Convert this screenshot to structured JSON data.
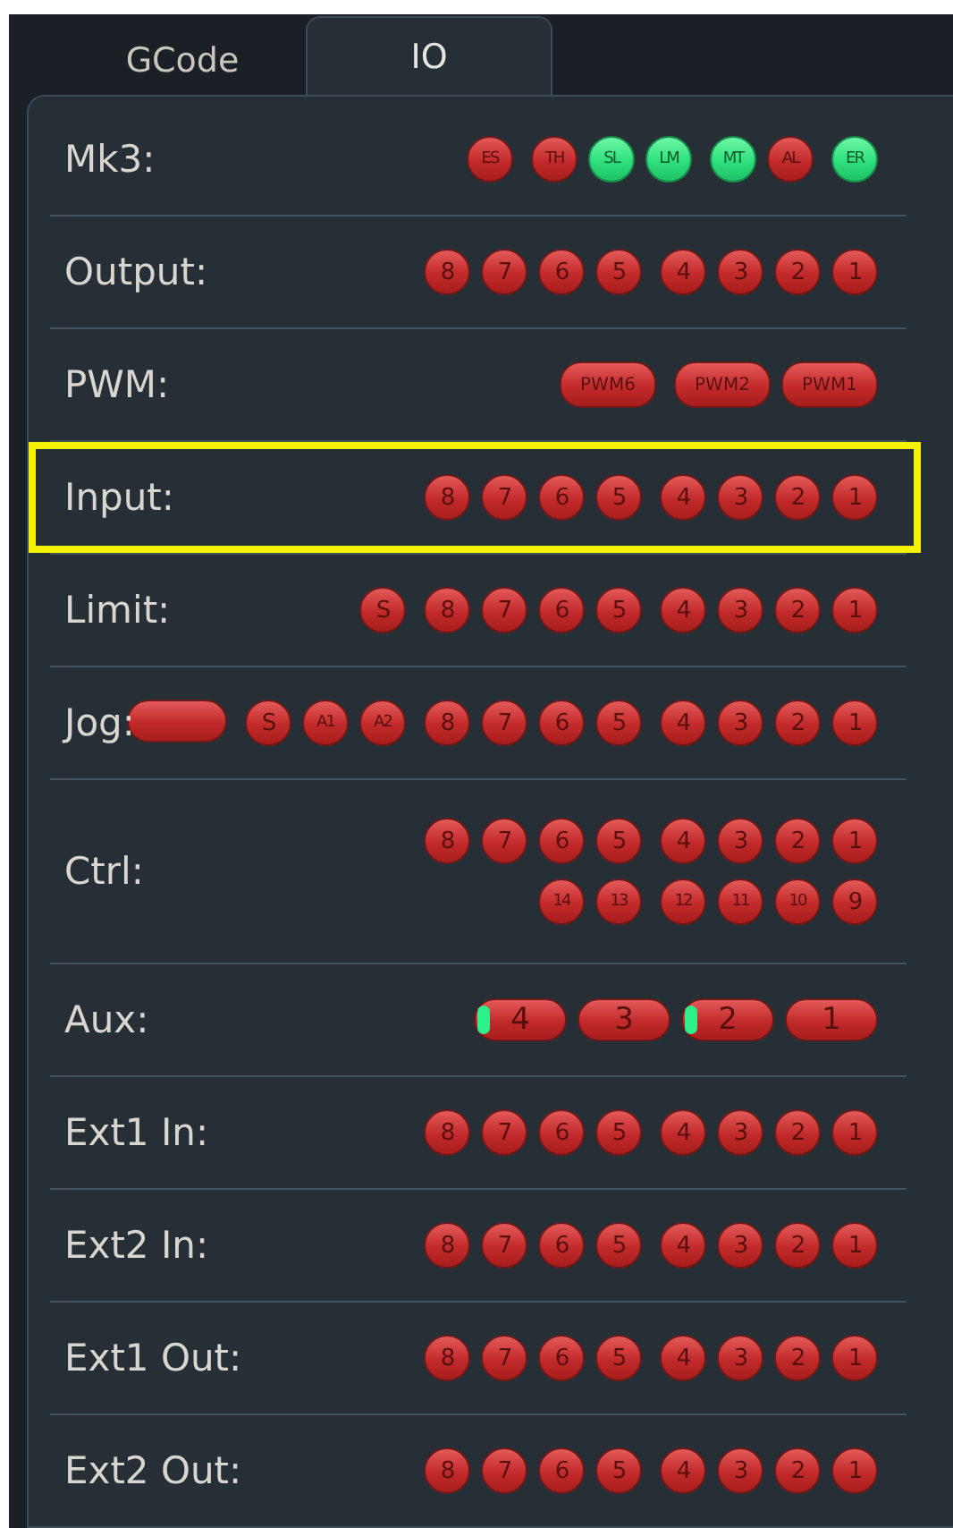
{
  "tabs": [
    {
      "label": "GCode",
      "selected": false
    },
    {
      "label": "IO",
      "selected": true
    }
  ],
  "rows": [
    {
      "label": "Mk3:",
      "highlighted": false,
      "lines": [
        [
          [
            {
              "kind": "dot",
              "label": "ES",
              "on": false
            }
          ],
          [
            {
              "kind": "dot",
              "label": "TH",
              "on": false
            },
            {
              "kind": "dot",
              "label": "SL",
              "on": true
            },
            {
              "kind": "dot",
              "label": "LM",
              "on": true
            }
          ],
          [
            {
              "kind": "dot",
              "label": "MT",
              "on": true
            },
            {
              "kind": "dot",
              "label": "AL",
              "on": false
            }
          ],
          [
            {
              "kind": "dot",
              "label": "ER",
              "on": true
            }
          ]
        ]
      ]
    },
    {
      "label": "Output:",
      "highlighted": false,
      "lines": [
        [
          [
            {
              "kind": "dot",
              "label": "8",
              "on": false
            },
            {
              "kind": "dot",
              "label": "7",
              "on": false
            },
            {
              "kind": "dot",
              "label": "6",
              "on": false
            },
            {
              "kind": "dot",
              "label": "5",
              "on": false
            }
          ],
          [
            {
              "kind": "dot",
              "label": "4",
              "on": false
            },
            {
              "kind": "dot",
              "label": "3",
              "on": false
            },
            {
              "kind": "dot",
              "label": "2",
              "on": false
            },
            {
              "kind": "dot",
              "label": "1",
              "on": false
            }
          ]
        ]
      ]
    },
    {
      "label": "PWM:",
      "highlighted": false,
      "lines": [
        [
          [
            {
              "kind": "pill",
              "label": "PWM6",
              "on": false
            }
          ],
          [
            {
              "kind": "pill",
              "label": "PWM2",
              "on": false
            },
            {
              "kind": "pill",
              "label": "PWM1",
              "on": false
            }
          ]
        ]
      ]
    },
    {
      "label": "Input:",
      "highlighted": true,
      "lines": [
        [
          [
            {
              "kind": "dot",
              "label": "8",
              "on": false
            },
            {
              "kind": "dot",
              "label": "7",
              "on": false
            },
            {
              "kind": "dot",
              "label": "6",
              "on": false
            },
            {
              "kind": "dot",
              "label": "5",
              "on": false
            }
          ],
          [
            {
              "kind": "dot",
              "label": "4",
              "on": false
            },
            {
              "kind": "dot",
              "label": "3",
              "on": false
            },
            {
              "kind": "dot",
              "label": "2",
              "on": false
            },
            {
              "kind": "dot",
              "label": "1",
              "on": false
            }
          ]
        ]
      ]
    },
    {
      "label": "Limit:",
      "highlighted": false,
      "lines": [
        [
          [
            {
              "kind": "dot",
              "label": "S",
              "on": false
            }
          ],
          [
            {
              "kind": "dot",
              "label": "8",
              "on": false
            },
            {
              "kind": "dot",
              "label": "7",
              "on": false
            },
            {
              "kind": "dot",
              "label": "6",
              "on": false
            },
            {
              "kind": "dot",
              "label": "5",
              "on": false
            }
          ],
          [
            {
              "kind": "dot",
              "label": "4",
              "on": false
            },
            {
              "kind": "dot",
              "label": "3",
              "on": false
            },
            {
              "kind": "dot",
              "label": "2",
              "on": false
            },
            {
              "kind": "dot",
              "label": "1",
              "on": false
            }
          ]
        ]
      ]
    },
    {
      "label": "Jog:",
      "highlighted": false,
      "lines": [
        [
          [
            {
              "kind": "pill",
              "on": false
            }
          ],
          [
            {
              "kind": "dot",
              "label": "S",
              "on": false
            },
            {
              "kind": "dot",
              "label": "A1",
              "on": false
            },
            {
              "kind": "dot",
              "label": "A2",
              "on": false
            }
          ],
          [
            {
              "kind": "dot",
              "label": "8",
              "on": false
            },
            {
              "kind": "dot",
              "label": "7",
              "on": false
            },
            {
              "kind": "dot",
              "label": "6",
              "on": false
            },
            {
              "kind": "dot",
              "label": "5",
              "on": false
            }
          ],
          [
            {
              "kind": "dot",
              "label": "4",
              "on": false
            },
            {
              "kind": "dot",
              "label": "3",
              "on": false
            },
            {
              "kind": "dot",
              "label": "2",
              "on": false
            },
            {
              "kind": "dot",
              "label": "1",
              "on": false
            }
          ]
        ]
      ]
    },
    {
      "label": "Ctrl:",
      "highlighted": false,
      "lines": [
        [
          [
            {
              "kind": "dot",
              "label": "8",
              "on": false
            },
            {
              "kind": "dot",
              "label": "7",
              "on": false
            },
            {
              "kind": "dot",
              "label": "6",
              "on": false
            },
            {
              "kind": "dot",
              "label": "5",
              "on": false
            }
          ],
          [
            {
              "kind": "dot",
              "label": "4",
              "on": false
            },
            {
              "kind": "dot",
              "label": "3",
              "on": false
            },
            {
              "kind": "dot",
              "label": "2",
              "on": false
            },
            {
              "kind": "dot",
              "label": "1",
              "on": false
            }
          ]
        ],
        [
          [
            {
              "kind": "dot",
              "label": "14",
              "on": false
            },
            {
              "kind": "dot",
              "label": "13",
              "on": false
            }
          ],
          [
            {
              "kind": "dot",
              "label": "12",
              "on": false
            },
            {
              "kind": "dot",
              "label": "11",
              "on": false
            },
            {
              "kind": "dot",
              "label": "10",
              "on": false
            },
            {
              "kind": "dot",
              "label": "9",
              "on": false
            }
          ]
        ]
      ]
    },
    {
      "label": "Aux:",
      "highlighted": false,
      "lines": [
        [
          [
            {
              "kind": "aux",
              "label": "4",
              "on": false,
              "indicator": true
            },
            {
              "kind": "aux",
              "label": "3",
              "on": false,
              "indicator": false
            },
            {
              "kind": "aux",
              "label": "2",
              "on": false,
              "indicator": true
            },
            {
              "kind": "aux",
              "label": "1",
              "on": false,
              "indicator": false
            }
          ]
        ]
      ]
    },
    {
      "label": "Ext1 In:",
      "highlighted": false,
      "lines": [
        [
          [
            {
              "kind": "dot",
              "label": "8",
              "on": false
            },
            {
              "kind": "dot",
              "label": "7",
              "on": false
            },
            {
              "kind": "dot",
              "label": "6",
              "on": false
            },
            {
              "kind": "dot",
              "label": "5",
              "on": false
            }
          ],
          [
            {
              "kind": "dot",
              "label": "4",
              "on": false
            },
            {
              "kind": "dot",
              "label": "3",
              "on": false
            },
            {
              "kind": "dot",
              "label": "2",
              "on": false
            },
            {
              "kind": "dot",
              "label": "1",
              "on": false
            }
          ]
        ]
      ]
    },
    {
      "label": "Ext2 In:",
      "highlighted": false,
      "lines": [
        [
          [
            {
              "kind": "dot",
              "label": "8",
              "on": false
            },
            {
              "kind": "dot",
              "label": "7",
              "on": false
            },
            {
              "kind": "dot",
              "label": "6",
              "on": false
            },
            {
              "kind": "dot",
              "label": "5",
              "on": false
            }
          ],
          [
            {
              "kind": "dot",
              "label": "4",
              "on": false
            },
            {
              "kind": "dot",
              "label": "3",
              "on": false
            },
            {
              "kind": "dot",
              "label": "2",
              "on": false
            },
            {
              "kind": "dot",
              "label": "1",
              "on": false
            }
          ]
        ]
      ]
    },
    {
      "label": "Ext1 Out:",
      "highlighted": false,
      "lines": [
        [
          [
            {
              "kind": "dot",
              "label": "8",
              "on": false
            },
            {
              "kind": "dot",
              "label": "7",
              "on": false
            },
            {
              "kind": "dot",
              "label": "6",
              "on": false
            },
            {
              "kind": "dot",
              "label": "5",
              "on": false
            }
          ],
          [
            {
              "kind": "dot",
              "label": "4",
              "on": false
            },
            {
              "kind": "dot",
              "label": "3",
              "on": false
            },
            {
              "kind": "dot",
              "label": "2",
              "on": false
            },
            {
              "kind": "dot",
              "label": "1",
              "on": false
            }
          ]
        ]
      ]
    },
    {
      "label": "Ext2 Out:",
      "highlighted": false,
      "lines": [
        [
          [
            {
              "kind": "dot",
              "label": "8",
              "on": false
            },
            {
              "kind": "dot",
              "label": "7",
              "on": false
            },
            {
              "kind": "dot",
              "label": "6",
              "on": false
            },
            {
              "kind": "dot",
              "label": "5",
              "on": false
            }
          ],
          [
            {
              "kind": "dot",
              "label": "4",
              "on": false
            },
            {
              "kind": "dot",
              "label": "3",
              "on": false
            },
            {
              "kind": "dot",
              "label": "2",
              "on": false
            },
            {
              "kind": "dot",
              "label": "1",
              "on": false
            }
          ]
        ]
      ]
    }
  ]
}
